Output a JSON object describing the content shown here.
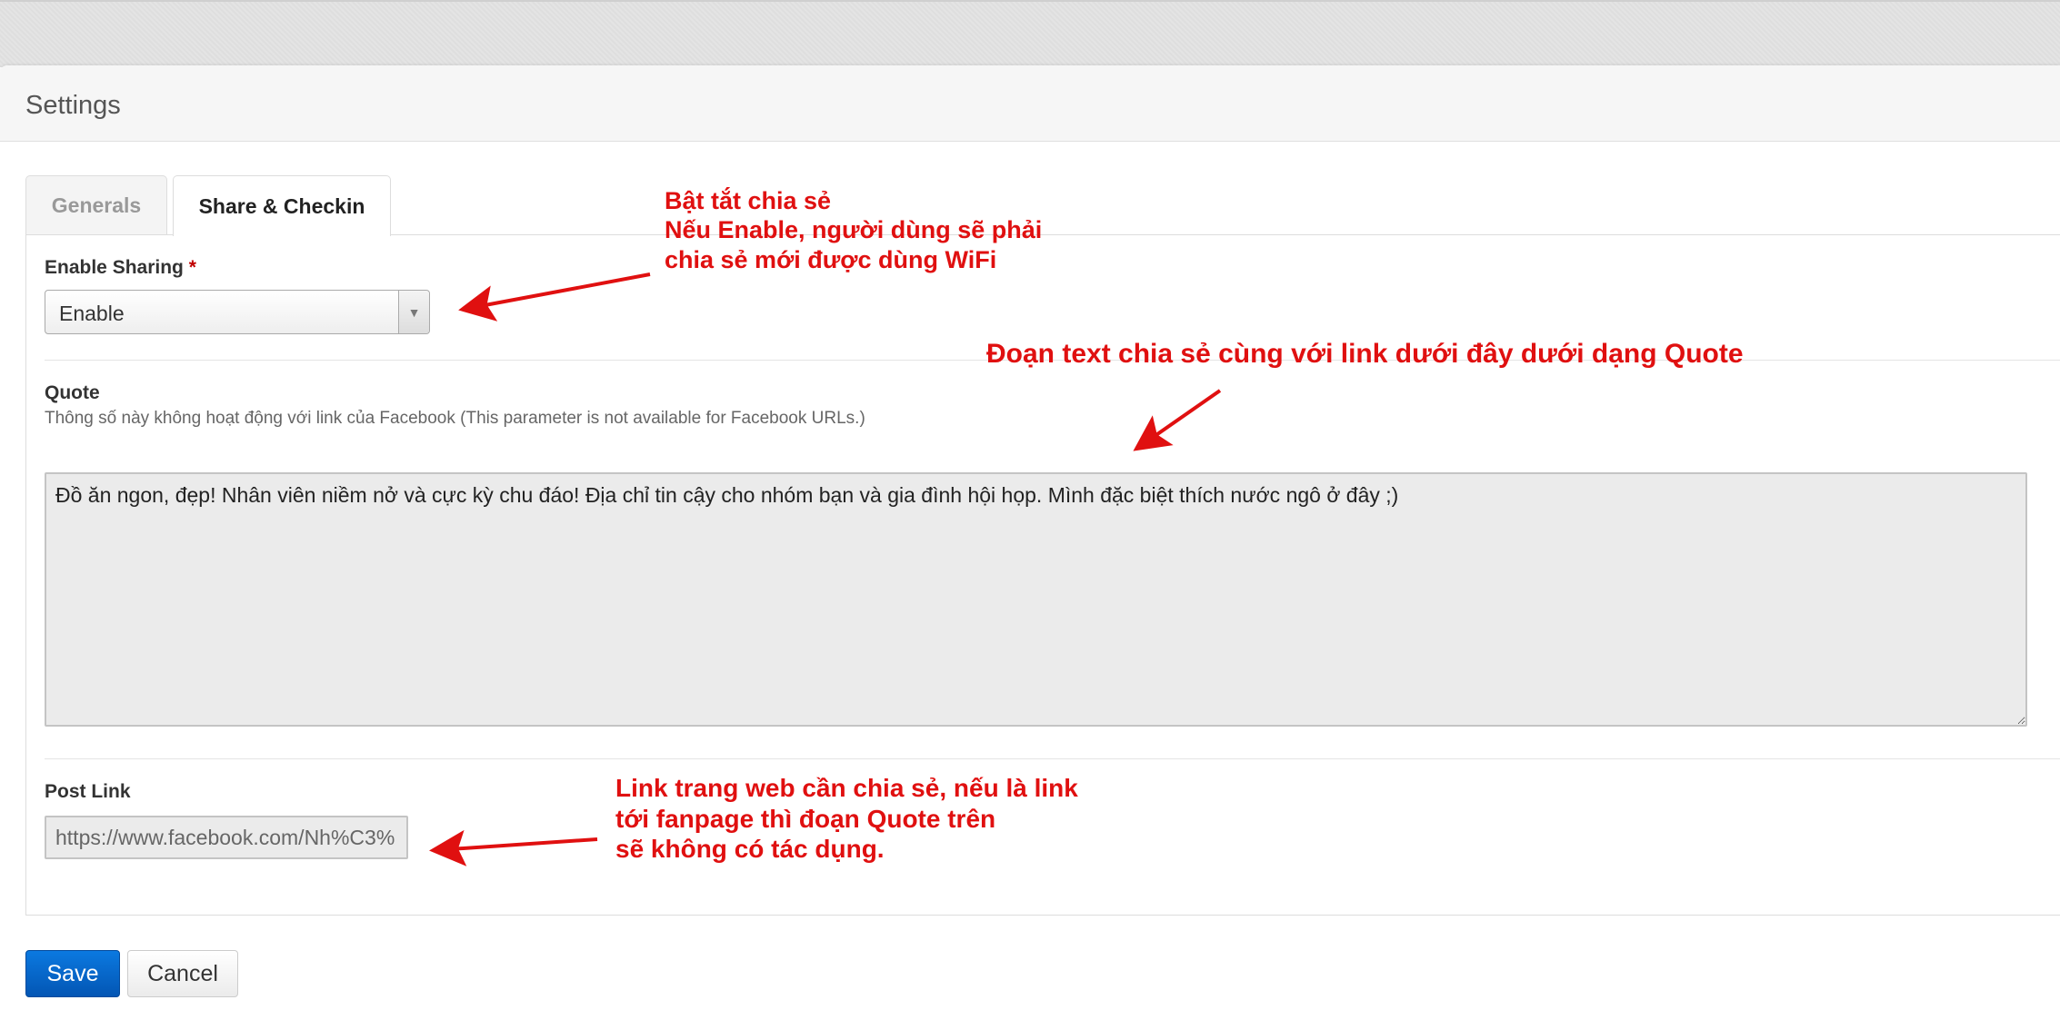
{
  "panel": {
    "title": "Settings"
  },
  "tabs": [
    {
      "label": "Generals",
      "active": false
    },
    {
      "label": "Share & Checkin",
      "active": true
    }
  ],
  "form": {
    "enable_sharing": {
      "label": "Enable Sharing",
      "required_mark": "*",
      "value": "Enable"
    },
    "quote": {
      "label": "Quote",
      "help": "Thông số này không hoạt động với link của Facebook (This parameter is not available for Facebook URLs.)",
      "value": "Đồ ăn ngon, đẹp! Nhân viên niềm nở và cực kỳ chu đáo! Địa chỉ tin cậy cho nhóm bạn và gia đình hội họp. Mình đặc biệt thích nước ngô ở đây ;)"
    },
    "post_link": {
      "label": "Post Link",
      "value": "https://www.facebook.com/Nh%C3%"
    }
  },
  "buttons": {
    "save": "Save",
    "cancel": "Cancel"
  },
  "annotations": {
    "sharing": [
      "Bật tắt chia sẻ",
      "Nếu Enable, người dùng sẽ phải",
      "chia sẻ mới được dùng WiFi"
    ],
    "quote": "Đoạn text chia sẻ cùng với link dưới đây dưới dạng Quote",
    "post_link": [
      "Link trang web cần chia sẻ, nếu là link",
      "tới fanpage thì đoạn Quote trên",
      "sẽ không có tác dụng."
    ]
  },
  "colors": {
    "annotation": "#e01010",
    "primary_button": "#0b79e0"
  }
}
